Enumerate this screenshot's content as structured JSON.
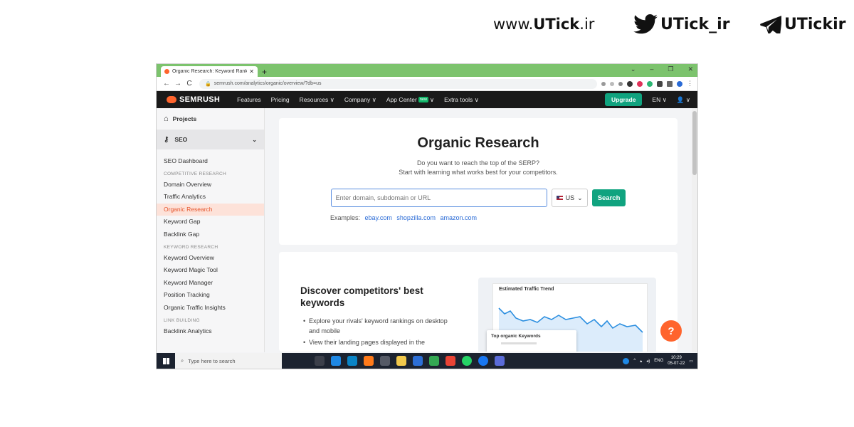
{
  "branding": {
    "site_prefix": "www.",
    "site_bold": "UTick",
    "site_suffix": ".ir",
    "twitter_handle": "UTick_ir",
    "telegram_handle": "UTickir"
  },
  "browser": {
    "tab_title": "Organic Research: Keyword Rank",
    "url": "semrush.com/analytics/organic/overview/?db=us"
  },
  "semrush_nav": {
    "logo": "SEMRUSH",
    "items": [
      "Features",
      "Pricing",
      "Resources ∨",
      "Company ∨"
    ],
    "app_center": "App Center",
    "new_badge": "new",
    "app_center_chev": "∨",
    "extra_tools": "Extra tools ∨",
    "upgrade": "Upgrade",
    "lang": "EN ∨"
  },
  "sidebar": {
    "projects": "Projects",
    "seo": "SEO",
    "seo_dashboard": "SEO Dashboard",
    "sec_competitive": "COMPETITIVE RESEARCH",
    "competitive": [
      "Domain Overview",
      "Traffic Analytics",
      "Organic Research",
      "Keyword Gap",
      "Backlink Gap"
    ],
    "sec_keyword": "KEYWORD RESEARCH",
    "keyword": [
      "Keyword Overview",
      "Keyword Magic Tool",
      "Keyword Manager",
      "Position Tracking",
      "Organic Traffic Insights"
    ],
    "sec_link": "LINK BUILDING",
    "link": [
      "Backlink Analytics"
    ]
  },
  "main": {
    "title": "Organic Research",
    "sub1": "Do you want to reach the top of the SERP?",
    "sub2": "Start with learning what works best for your competitors.",
    "search_placeholder": "Enter domain, subdomain or URL",
    "country": "US",
    "search_button": "Search",
    "examples_label": "Examples:",
    "examples": [
      "ebay.com",
      "shopzilla.com",
      "amazon.com"
    ],
    "promo_title": "Discover competitors' best keywords",
    "bullets": [
      "Explore your rivals' keyword rankings on desktop and mobile",
      "View their landing pages displayed in the"
    ],
    "chart_title": "Estimated Traffic Trend",
    "top_keywords": "Top organic Keywords",
    "help": "?"
  },
  "taskbar": {
    "search_placeholder": "Type here to search",
    "lang": "ENG",
    "time": "10:29",
    "date": "05-07-22"
  },
  "colors": {
    "accent": "#ff642d",
    "green": "#10a37f",
    "tabbar": "#7cc36d"
  }
}
